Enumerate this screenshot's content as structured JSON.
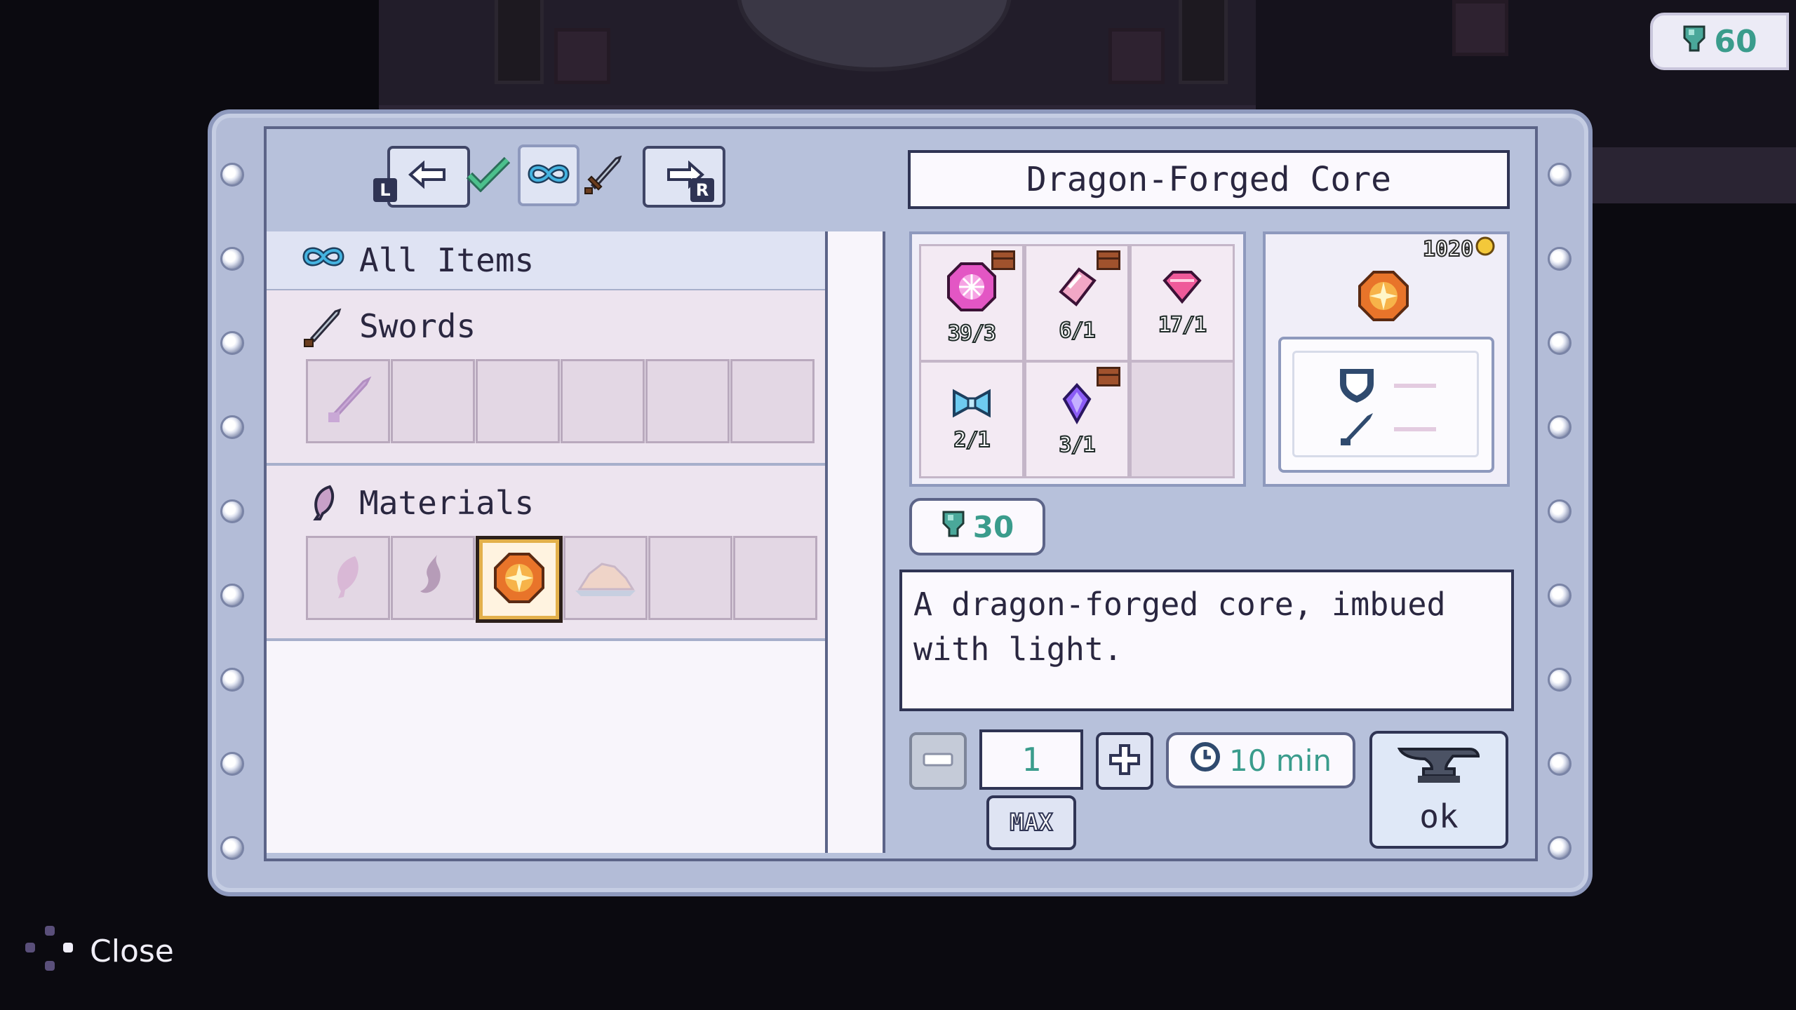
{
  "hud": {
    "gem_count": "60"
  },
  "nav": {
    "prev_trigger": "L",
    "next_trigger": "R",
    "tabs": [
      {
        "name": "check",
        "icon": "check-icon"
      },
      {
        "name": "all",
        "icon": "infinity-icon",
        "active": true
      },
      {
        "name": "swords",
        "icon": "sword-icon"
      }
    ]
  },
  "item_title": "Dragon-Forged Core",
  "categories": [
    {
      "label": "All Items",
      "icon": "infinity-icon"
    },
    {
      "label": "Swords",
      "icon": "sword-icon",
      "slots": [
        "sword-item-icon",
        "",
        "",
        "",
        "",
        ""
      ]
    },
    {
      "label": "Materials",
      "icon": "feather-icon",
      "slots": [
        "feather-item-icon",
        "claw-item-icon",
        "dragon-core-item-icon",
        "ore-item-icon",
        "",
        ""
      ],
      "selected_index": 2
    }
  ],
  "ingredients": [
    {
      "icon": "pink-orb-icon",
      "qty": "39/3",
      "chest": true
    },
    {
      "icon": "pink-crystal-icon",
      "qty": "6/1",
      "chest": true
    },
    {
      "icon": "pink-gem-icon",
      "qty": "17/1",
      "chest": false
    },
    {
      "icon": "blue-bow-icon",
      "qty": "2/1",
      "chest": false
    },
    {
      "icon": "purple-crystal-icon",
      "qty": "3/1",
      "chest": true
    },
    {
      "icon": "",
      "qty": "",
      "chest": false
    }
  ],
  "result": {
    "price": "1020",
    "icon": "dragon-core-icon"
  },
  "gem_cost": "30",
  "description": "A dragon-forged core, imbued with light.",
  "craft": {
    "quantity": "1",
    "max_label": "MAX",
    "time": "10 min",
    "ok_label": "ok"
  },
  "hints": {
    "close_label": "Close"
  },
  "colors": {
    "gem_teal": "#3a9c8c",
    "frame": "#b3bcd7",
    "panel": "#f8f5fb"
  }
}
